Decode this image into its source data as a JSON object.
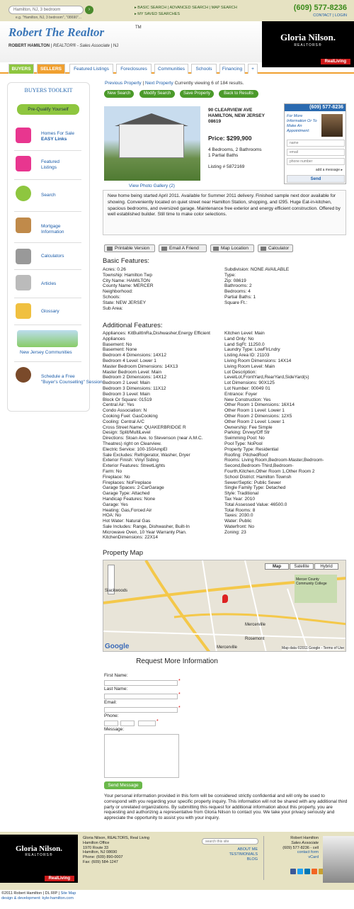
{
  "top": {
    "search_placeholder": "Hamilton, NJ, 3 bedroom",
    "search_example": "e.g. \"Hamilton, NJ, 3 bedroom\", \"08690\"...",
    "links": [
      "BASIC SEARCH",
      "ADVANCED SEARCH",
      "MAP SEARCH"
    ],
    "saved": "MY SAVED SEARCHES",
    "phone": "(609) 577-8236",
    "contact": "CONTACT",
    "login": "LOGIN"
  },
  "header": {
    "logo": "Robert The Realtor",
    "tm": "TM",
    "name": "ROBERT HAMILTON",
    "title": "REALTOR® - Sales Associate",
    "state": "NJ",
    "brand": "Gloria Nilson.",
    "brand_sub": "REALTORS®",
    "rl": "RealLiving"
  },
  "nav": [
    "BUYERS",
    "SELLERS",
    "Featured Listings",
    "Foreclosures",
    "Communities",
    "Schools",
    "Financing",
    "+"
  ],
  "toolkit": {
    "title": "BUYERS TOOLKIT",
    "prequal": "Pre-Qualify Yourself",
    "items": [
      [
        "Homes For Sale",
        "EASY Links"
      ],
      [
        "Featured",
        "Listings"
      ],
      [
        "Search",
        ""
      ],
      [
        "Mortgage",
        "Information"
      ],
      [
        "Calculators",
        ""
      ],
      [
        "Articles",
        ""
      ],
      [
        "Glossary",
        ""
      ],
      [
        "New Jersey Communities",
        ""
      ],
      [
        "Schedule a Free",
        "\"Buyer's Counselling\" Session"
      ]
    ]
  },
  "pager": {
    "prev": "Previous Property",
    "sep": "|",
    "next": "Next Property",
    "status": "Currently viewing 6 of 184 results."
  },
  "buttons": [
    "New Search",
    "Modify Search",
    "Save Property",
    "Back to Results"
  ],
  "property": {
    "gallery": "View Photo Gallery (2)",
    "addr1": "90 CLEARVIEW AVE",
    "addr2": "HAMILTON, NEW JERSEY",
    "zip": "08619",
    "price": "Price: $299,900",
    "beds": "4 Bedrooms, 2 Bathrooms",
    "partial": "1 Partial Baths",
    "listing": "Listing # 5872169",
    "desc": "New home being started April 2011. Available for Summer 2011 delivery. Finished sample next door available for showing. Conveniently located on quiet street near Hamilton Station, shopping, and I295. Huge Eat-in-kitchen, spacious bedrooms, and oversized garage. Maintenance free exterior and energy efficient construction. Offered by well established builder. Still time to make color selections."
  },
  "agent": {
    "phone": "(609) 577-8236",
    "text": "For More Information Or To Make An Appointment:",
    "name": "name",
    "email": "email",
    "phone_ph": "phone number",
    "add": "add a message",
    "send": "Send"
  },
  "tools": [
    "Printable Version",
    "Email A Friend",
    "Map Location",
    "Calculator"
  ],
  "basic": {
    "title": "Basic Features:",
    "left": [
      "Acres: 0.26",
      "Township: Hamilton Twp",
      "City Name: HAMILTON",
      "County Name: MERCER",
      "Neighborhood:",
      "Schools:",
      "State: NEW JERSEY",
      "Sub Area:"
    ],
    "right": [
      "Subdivision: NONE AVAILABLE",
      "Type:",
      "Zip: 08619",
      "Bathrooms: 2",
      "Bedrooms: 4",
      "Partial Baths: 1",
      "Square Ft.:"
    ]
  },
  "additional": {
    "title": "Additional Features:",
    "left": [
      "Appliances: KitBuiltInRa,Dishwasher,Energy Efficient",
      "Appliances",
      "Basement: No",
      "Basement: None",
      "Bedroom 4 Dimensions: 14X12",
      "Bedroom 4 Level: Lower 1",
      "Master Bedroom Dimensions: 14X13",
      "Master Bedroom Level: Main",
      "Bedroom 2 Dimensions: 14X12",
      "Bedroom 2 Level: Main",
      "Bedroom 3 Dimensions: 11X12",
      "Bedroom 3 Level: Main",
      "Block Or Square: 01519",
      "Central Air: Yes",
      "Condo Association: N",
      "Cooking Fuel: GasCooking",
      "Cooling: Central A/C",
      "Cross Street Name: QUAKERBRIDGE R",
      "Design: Split/MultiLevel",
      "Directions: Sloan Ave. to Stevenson (near A.M.C.",
      "Theatres) right on Clearview.",
      "Electric Service: 100-150AmpEl",
      "Sale Excludes: Refrigerator, Washer, Dryer",
      "Exterior Finish: Vinyl Siding",
      "Exterior Features: StreetLights",
      "Farm: No",
      "Fireplace: No",
      "Fireplaces: NoFireplace",
      "Garage Spaces: 2-CarGarage",
      "Garage Type: Attached",
      "Handicap Features: None",
      "Garage: Yes",
      "Heating: Gas,Forced Air",
      "HOA: No",
      "Hot Water: Natural Gas",
      "Sale Includes: Range, Dishwasher, Built-In",
      "Microwave Oven, 10 Year Warranty Plan.",
      "KitchenDimensions: 22X14"
    ],
    "right": [
      "Kitchen Level: Main",
      "Land Only: No",
      "Land SqFt: 11250.0",
      "Laundry Type: LowFlrLndry",
      "Listing Area ID: 21103",
      "Living Room Dimensions: 14X14",
      "Living Room Level: Main",
      "Lot Description:",
      "LevelLot,FrontYard,RearYard,SideYard(s)",
      "Lot Dimensions: 90X125",
      "Lot Number: 00049 01",
      "Entrance: Foyer",
      "New Construction: Yes",
      "Other Room 1 Dimensions: 16X14",
      "Other Room 1 Level: Lower 1",
      "Other Room 2 Dimensions: 12X5",
      "Other Room 2 Level: Lower 1",
      "Ownership: Fee Simple",
      "Parking: Drvwy/Off Str",
      "Swimming Pool: No",
      "Pool Type: NoPool",
      "Property Type: Residential",
      "Roofing: PitchedRoof",
      "Rooms: Living Room,Bedroom-Master,Bedroom-",
      "Second,Bedroom-Third,Bedroom-",
      "Fourth,Kitchen,Other Room 1,Other Room 2",
      "School District: Hamilton Townsh",
      "Sewer/Septic: Public Sewer",
      "Single Family Type: Detached",
      "Style: Traditional",
      "Tax Year: 2010",
      "Total Assessed Value: 46500.0",
      "Total Rooms: 8",
      "Taxes: 2030.0",
      "Water: Public",
      "Waterfront: No",
      "Zoning: 23"
    ]
  },
  "map": {
    "title": "Property Map",
    "types": [
      "Map",
      "Satellite",
      "Hybrid"
    ],
    "labels": [
      "Slackwoods",
      "Mercerville",
      "Rosemont",
      "Mercerville",
      "Mercer County Community College"
    ],
    "copy": "Map data ©2011 Google - Terms of Use",
    "google": "Google"
  },
  "form": {
    "title": "Request More Information",
    "first": "First Name:",
    "last": "Last Name:",
    "email": "Email:",
    "phone": "Phone:",
    "message": "Message:",
    "send": "Send Message",
    "privacy": "Your personal information provided in this form will be considered strictly confidential and will only be used to correspond with you regarding your specific property inquiry. This information will not be shared with any additional third party or unrelated organizations. By submitting this request for additional information about this property, you are requesting and authorizing a representative from Gloria Nilson to contact you. We take your privacy seriously and appreciate the opportunity to assist you with your inquiry."
  },
  "footer": {
    "office": [
      "Gloria Nilson, REALTORS, Real Living",
      "Hamilton Office",
      "1970 Route 33",
      "Hamilton, NJ 08690",
      "Phone: (609) 890-0007",
      "Fax: (609) 584-1247"
    ],
    "search": "search this site",
    "links": [
      "ABOUT ME",
      "TESTIMONIALS",
      "BLOG"
    ],
    "agent": [
      "Robert Hamilton",
      "Sales Associate",
      "(609) 577-8236 - cell",
      "contact form",
      "vCard"
    ],
    "copy": "©2011 Robert Hamilton",
    "dlrip": "DL RIP",
    "sitemap": "Site Map",
    "design": "design & development: kyle-hamilton.com"
  }
}
